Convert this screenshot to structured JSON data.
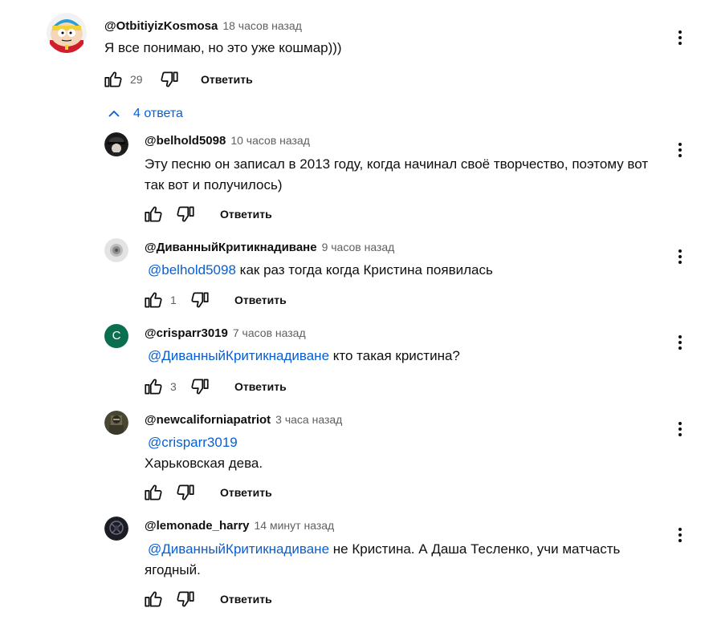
{
  "main_comment": {
    "author": "@OtbitiyizKosmosa",
    "time": "18 часов назад",
    "text": "Я все понимаю, но это уже кошмар)))",
    "likes": "29",
    "reply_label": "Ответить"
  },
  "replies_toggle": {
    "label": "4 ответа"
  },
  "replies": [
    {
      "author": "@belhold5098",
      "time": "10 часов назад",
      "mention": "",
      "text": "Эту песню он записал в 2013 году, когда начинал своё творчество, поэтому вот так вот и получилось)",
      "likes": "",
      "reply_label": "Ответить"
    },
    {
      "author": "@ДиванныйКритикнадиване",
      "time": "9 часов назад",
      "mention": "@belhold5098",
      "text": "как раз тогда когда Кристина появилась",
      "likes": "1",
      "reply_label": "Ответить"
    },
    {
      "author": "@crisparr3019",
      "time": "7 часов назад",
      "mention": "@ДиванныйКритикнадиване",
      "text": "кто такая кристина?",
      "likes": "3",
      "reply_label": "Ответить",
      "avatar_letter": "C"
    },
    {
      "author": "@newcaliforniapatriot",
      "time": "3 часа назад",
      "mention": "@crisparr3019",
      "text": "Харьковская дева.",
      "likes": "",
      "reply_label": "Ответить"
    },
    {
      "author": "@lemonade_harry",
      "time": "14 минут назад",
      "mention": "@ДиванныйКритикнадиване",
      "text": "не Кристина. А Даша Тесленко, учи матчасть ягодный.",
      "likes": "",
      "reply_label": "Ответить"
    }
  ],
  "colors": {
    "link": "#065fd4",
    "text": "#0f0f0f",
    "secondary": "#606060",
    "avatar_c": "#0b6e4f"
  },
  "icons": {
    "like": "thumb-up-icon",
    "dislike": "thumb-down-icon",
    "menu": "more-vert-icon",
    "toggle": "chevron-up-icon"
  }
}
